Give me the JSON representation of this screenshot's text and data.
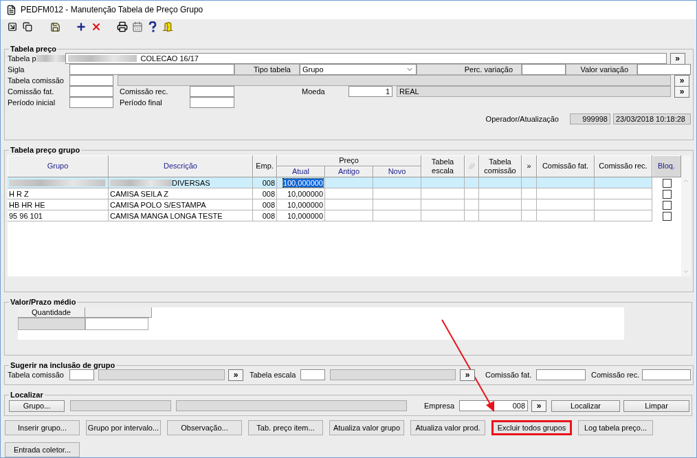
{
  "window": {
    "title": "PEDFM012 - Manutenção Tabela de Preço Grupo"
  },
  "tabela_preco": {
    "title": "Tabela preço",
    "tabela_label": "Tabela p",
    "tabela_value": "COLECAO 16/17",
    "tabela_lookup": "»",
    "sigla_label": "Sigla",
    "tipo_tabela_label": "Tipo tabela",
    "tipo_tabela_value": "Grupo",
    "perc_variacao_label": "Perc. variação",
    "valor_variacao_label": "Valor variação",
    "tabela_comissao_label": "Tabela comissão",
    "tabela_comissao_lookup": "»",
    "comissao_fat_label": "Comissão fat.",
    "comissao_rec_label": "Comissão rec.",
    "moeda_label": "Moeda",
    "moeda_code": "1",
    "moeda_name": "REAL",
    "moeda_lookup": "»",
    "periodo_inicial_label": "Período inicial",
    "periodo_final_label": "Período final",
    "operador_label": "Operador/Atualização",
    "operador_value": "999998",
    "atualizacao_value": "23/03/2018 10:18:28"
  },
  "grupo_grid": {
    "title": "Tabela preço grupo",
    "price_group": "Preço",
    "columns": [
      {
        "label": "Grupo",
        "accent": true
      },
      {
        "label": "Descrição",
        "accent": true
      },
      {
        "label": "Emp.",
        "accent": false
      },
      {
        "label": "Atual",
        "accent": true
      },
      {
        "label": "Antigo",
        "accent": true
      },
      {
        "label": "Novo",
        "accent": true
      },
      {
        "label": "Tabela escala",
        "accent": false
      },
      {
        "label": "Tabela comissão",
        "accent": false
      },
      {
        "label": "»",
        "accent": false
      },
      {
        "label": "Comissão fat.",
        "accent": false
      },
      {
        "label": "Comissão rec.",
        "accent": false
      },
      {
        "label": "Bloq.",
        "accent": true
      }
    ],
    "rows": [
      {
        "redacted": true,
        "descricao": "DIVERSAS",
        "emp": "008",
        "atual": "100,000000",
        "selected": true,
        "bloq": false
      },
      {
        "redacted": false,
        "grupo": "H R Z",
        "descricao": "CAMISA SEILA Z",
        "emp": "008",
        "atual": "10,000000",
        "selected": false,
        "bloq": false
      },
      {
        "redacted": false,
        "grupo": "HB HR HE",
        "descricao": "CAMISA POLO S/ESTAMPA",
        "emp": "008",
        "atual": "10,000000",
        "selected": false,
        "bloq": false
      },
      {
        "redacted": false,
        "grupo": "95 96 101",
        "descricao": "CAMISA MANGA LONGA TESTE",
        "emp": "008",
        "atual": "10,000000",
        "selected": false,
        "bloq": false
      }
    ]
  },
  "valor_prazo": {
    "title": "Valor/Prazo médio",
    "column": "Quantidade"
  },
  "sugerir": {
    "title": "Sugerir na inclusão de grupo",
    "tabela_comissao_label": "Tabela comissão",
    "tabela_comissao_lookup": "»",
    "tabela_escala_label": "Tabela escala",
    "tabela_escala_lookup": "»",
    "comissao_fat_label": "Comissão fat.",
    "comissao_rec_label": "Comissão rec."
  },
  "localizar": {
    "title": "Localizar",
    "grupo_button": "Grupo...",
    "empresa_label": "Empresa",
    "empresa_value": "008",
    "empresa_lookup": "»",
    "localizar_button": "Localizar",
    "limpar_button": "Limpar"
  },
  "actions": [
    {
      "label": "Inserir grupo...",
      "highlighted": false
    },
    {
      "label": "Grupo por intervalo...",
      "highlighted": false
    },
    {
      "label": "Observação...",
      "highlighted": false
    },
    {
      "label": "Tab. preço item...",
      "highlighted": false
    },
    {
      "label": "Atualiza valor grupo",
      "highlighted": false
    },
    {
      "label": "Atualiza valor prod.",
      "highlighted": false
    },
    {
      "label": "Excluir todos grupos",
      "highlighted": true
    },
    {
      "label": "Log tabela preço...",
      "highlighted": false
    },
    {
      "label": "Entrada coletor...",
      "highlighted": false
    }
  ]
}
